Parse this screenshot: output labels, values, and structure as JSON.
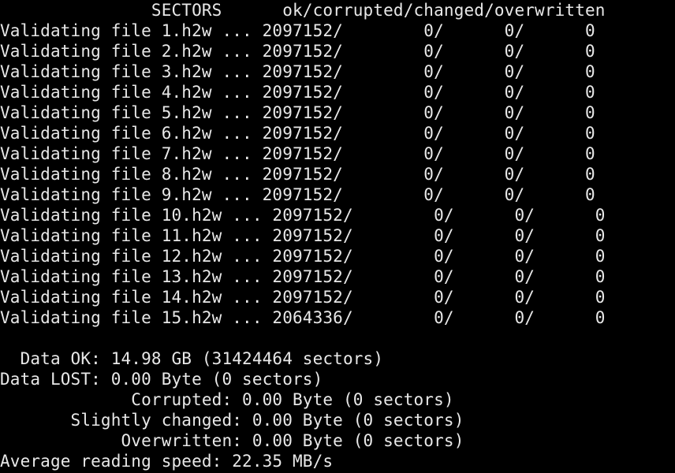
{
  "terminal": {
    "background_color": "#000000",
    "text_color": "#e8e8e8",
    "lines": [
      "               SECTORS      ok/corrupted/changed/overwritten",
      "Validating file 1.h2w ... 2097152/        0/      0/      0",
      "Validating file 2.h2w ... 2097152/        0/      0/      0",
      "Validating file 3.h2w ... 2097152/        0/      0/      0",
      "Validating file 4.h2w ... 2097152/        0/      0/      0",
      "Validating file 5.h2w ... 2097152/        0/      0/      0",
      "Validating file 6.h2w ... 2097152/        0/      0/      0",
      "Validating file 7.h2w ... 2097152/        0/      0/      0",
      "Validating file 8.h2w ... 2097152/        0/      0/      0",
      "Validating file 9.h2w ... 2097152/        0/      0/      0",
      "Validating file 10.h2w ... 2097152/        0/      0/      0",
      "Validating file 11.h2w ... 2097152/        0/      0/      0",
      "Validating file 12.h2w ... 2097152/        0/      0/      0",
      "Validating file 13.h2w ... 2097152/        0/      0/      0",
      "Validating file 14.h2w ... 2097152/        0/      0/      0",
      "Validating file 15.h2w ... 2064336/        0/      0/      0",
      "",
      "  Data OK: 14.98 GB (31424464 sectors)",
      "Data LOST: 0.00 Byte (0 sectors)",
      "             Corrupted: 0.00 Byte (0 sectors)",
      "       Slightly changed: 0.00 Byte (0 sectors)",
      "            Overwritten: 0.00 Byte (0 sectors)",
      "Average reading speed: 22.35 MB/s"
    ]
  }
}
